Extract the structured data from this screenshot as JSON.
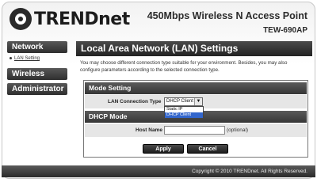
{
  "header": {
    "brand": "TRENDnet",
    "product_title": "450Mbps Wireless N Access Point",
    "model": "TEW-690AP"
  },
  "sidebar": {
    "items": [
      {
        "label": "Network",
        "subitems": [
          {
            "label": "LAN Setting"
          }
        ]
      },
      {
        "label": "Wireless"
      },
      {
        "label": "Administrator"
      }
    ]
  },
  "main": {
    "title": "Local Area Network (LAN) Settings",
    "description": "You may choose different connection type suitable for your environment. Besides, you may also configure parameters according to the selected connection type.",
    "mode_section": {
      "title": "Mode Setting",
      "lan_type_label": "LAN Connection Type",
      "lan_type_value": "DHCP Client",
      "options": [
        "Static IP",
        "DHCP Client"
      ],
      "selected_option": "DHCP Client"
    },
    "dhcp_section": {
      "title": "DHCP Mode",
      "host_name_label": "Host Name",
      "host_name_value": "",
      "host_name_hint": "(optional)"
    },
    "buttons": {
      "apply": "Apply",
      "cancel": "Cancel"
    }
  },
  "footer": {
    "copyright": "Copyright © 2010 TRENDnet. All Rights Reserved."
  }
}
